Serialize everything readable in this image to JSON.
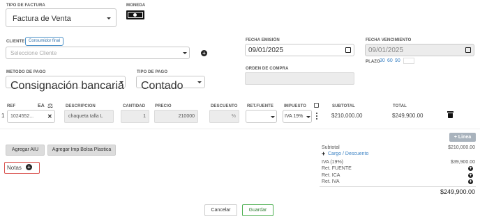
{
  "invoice_type": {
    "label": "TIPO DE FACTURA",
    "value": "Factura de Venta"
  },
  "currency": {
    "label": "MONEDA"
  },
  "client": {
    "label": "CLIENTE",
    "badge": "Consumidor final",
    "placeholder": "Seleccione Cliente"
  },
  "issue_date": {
    "label": "FECHA EMISIÓN",
    "value": "09/01/2025"
  },
  "due_date": {
    "label": "FECHA VENCIMIENTO",
    "value": "09/01/2025"
  },
  "term": {
    "label": "PLAZO",
    "options": [
      "30",
      "60",
      "90"
    ]
  },
  "purchase_order": {
    "label": "ORDEN DE COMPRA"
  },
  "payment_method": {
    "label": "METODO DE PAGO",
    "value": "Consignación bancaria"
  },
  "payment_type": {
    "label": "TIPO DE PAGO",
    "value": "Contado"
  },
  "items": {
    "headers": {
      "ref": "REF",
      "ea": "EA",
      "description": "DESCRIPCION",
      "quantity": "CANTIDAD",
      "price": "PRECIO",
      "discount": "DESCUENTO",
      "ret_fuente": "RET.FUENTE",
      "tax": "IMPUESTO",
      "subtotal": "SUBTOTAL",
      "total": "TOTAL"
    },
    "rows": [
      {
        "num": "1",
        "ref": "1024552...",
        "description": "chaqueta talla L",
        "quantity": "1",
        "price": "210000",
        "discount_unit": "%",
        "tax": "IVA 19%",
        "subtotal": "$210,000.00",
        "total": "$249,900.00"
      }
    ],
    "add_line": "+ Linea"
  },
  "actions": {
    "aiu": "Agregar AIU",
    "bolsa": "Agregar Imp Bolsa Plastica"
  },
  "notes": {
    "label": "Notas"
  },
  "totals": {
    "subtotal_label": "Subtotal",
    "subtotal_value": "$210,000.00",
    "charge_discount": "Cargo / Descuento",
    "iva_label": "IVA (19%)",
    "iva_value": "$39,900.00",
    "ret_fuente": "Ret. FUENTE",
    "ret_ica": "Ret. ICA",
    "ret_iva": "Ret. IVA",
    "grand_total": "$249,900.00"
  },
  "footer": {
    "cancel": "Cancelar",
    "save": "Guardar"
  }
}
